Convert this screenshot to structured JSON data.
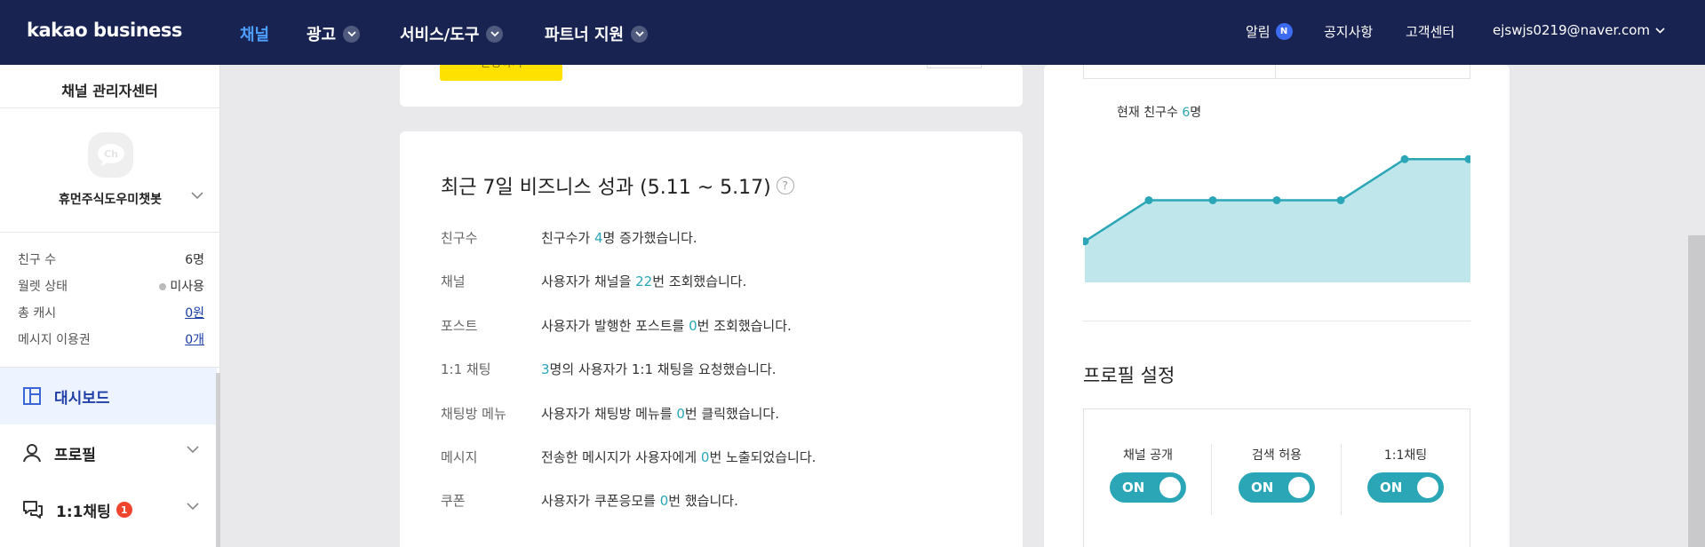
{
  "nav": {
    "logo": "kakao business",
    "items": [
      {
        "label": "채널",
        "active": true,
        "dropdown": false
      },
      {
        "label": "광고",
        "active": false,
        "dropdown": true
      },
      {
        "label": "서비스/도구",
        "active": false,
        "dropdown": true
      },
      {
        "label": "파트너 지원",
        "active": false,
        "dropdown": true
      }
    ],
    "notifications_label": "알림",
    "notifications_badge": "N",
    "notice_label": "공지사항",
    "support_label": "고객센터",
    "account_email": "ejswjs0219@naver.com"
  },
  "sidebar": {
    "title": "채널 관리자센터",
    "avatar_text": "Ch",
    "channel_name": "휴먼주식도우미챗봇",
    "stats": [
      {
        "label": "친구 수",
        "value": "6명",
        "link": false,
        "dot": false
      },
      {
        "label": "월렛 상태",
        "value": "미사용",
        "link": false,
        "dot": true
      },
      {
        "label": "총 캐시",
        "value": "0원",
        "link": true,
        "dot": false
      },
      {
        "label": "메시지 이용권",
        "value": "0개",
        "link": true,
        "dot": false
      }
    ],
    "menu": [
      {
        "label": "대시보드",
        "icon": "dashboard-icon",
        "active": true
      },
      {
        "label": "프로필",
        "icon": "person-icon",
        "active": false
      },
      {
        "label": "1:1채팅",
        "icon": "chat-icon",
        "active": false,
        "badge": "1"
      }
    ]
  },
  "top_card": {
    "button_label": "신청하기"
  },
  "performance": {
    "title": "최근 7일 비즈니스 성과 (5.11 ~ 5.17)",
    "rows": [
      {
        "label": "친구수",
        "pre": "친구수가 ",
        "num": "4",
        "post": "명 증가했습니다."
      },
      {
        "label": "채널",
        "pre": "사용자가 채널을 ",
        "num": "22",
        "post": "번 조회했습니다."
      },
      {
        "label": "포스트",
        "pre": "사용자가 발행한 포스트를 ",
        "num": "0",
        "post": "번 조회했습니다."
      },
      {
        "label": "1:1 채팅",
        "pre": "",
        "num": "3",
        "post": "명의 사용자가 1:1 채팅을 요청했습니다."
      },
      {
        "label": "채팅방 메뉴",
        "pre": "사용자가 채팅방 메뉴를 ",
        "num": "0",
        "post": "번 클릭했습니다."
      },
      {
        "label": "메시지",
        "pre": "전송한 메시지가 사용자에게 ",
        "num": "0",
        "post": "번 노출되었습니다."
      },
      {
        "label": "쿠폰",
        "pre": "사용자가 쿠폰응모를 ",
        "num": "0",
        "post": "번 했습니다."
      }
    ]
  },
  "friends_chart": {
    "label_pre": "현재 친구수 ",
    "label_num": "6",
    "label_post": "명"
  },
  "chart_data": {
    "type": "area",
    "series": [
      {
        "values": [
          2,
          4,
          4,
          4,
          4,
          6,
          6
        ]
      }
    ],
    "ylim": [
      0,
      8
    ],
    "grid": false,
    "color": "#2aa6b7",
    "fill": "#bfe6ea"
  },
  "profile": {
    "title": "프로필 설정",
    "toggles": [
      {
        "label": "채널 공개",
        "state": "ON"
      },
      {
        "label": "검색 허용",
        "state": "ON"
      },
      {
        "label": "1:1채팅",
        "state": "ON"
      }
    ]
  },
  "colors": {
    "nav_bg": "#182351",
    "accent": "#2aa6b7",
    "active_nav": "#4da0ff",
    "yellow": "#ffe100"
  }
}
